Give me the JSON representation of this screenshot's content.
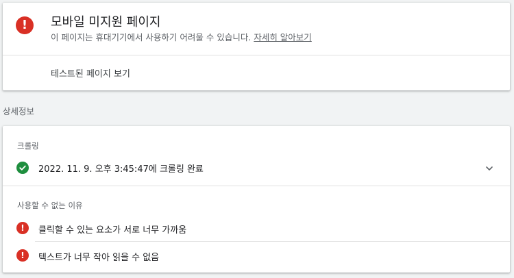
{
  "status": {
    "title": "모바일 미지원 페이지",
    "subtitle": "이 페이지는 휴대기기에서 사용하기 어려울 수 있습니다.",
    "learn_more_link": "자세히 알아보기",
    "view_tested_page": "테스트된 페이지 보기",
    "icon": "error-icon",
    "color": "#d93025"
  },
  "details": {
    "heading": "상세정보",
    "crawl": {
      "label": "크롤링",
      "status_text": "2022. 11. 9. 오후 3:45:47에 크롤링 완료",
      "icon": "check-circle-icon",
      "color": "#1e8e3e"
    },
    "reasons": {
      "label": "사용할 수 없는 이유",
      "items": [
        {
          "text": "클릭할 수 있는 요소가 서로 너무 가까움",
          "icon": "error-icon"
        },
        {
          "text": "텍스트가 너무 작아 읽을 수 없음",
          "icon": "error-icon"
        }
      ]
    }
  }
}
